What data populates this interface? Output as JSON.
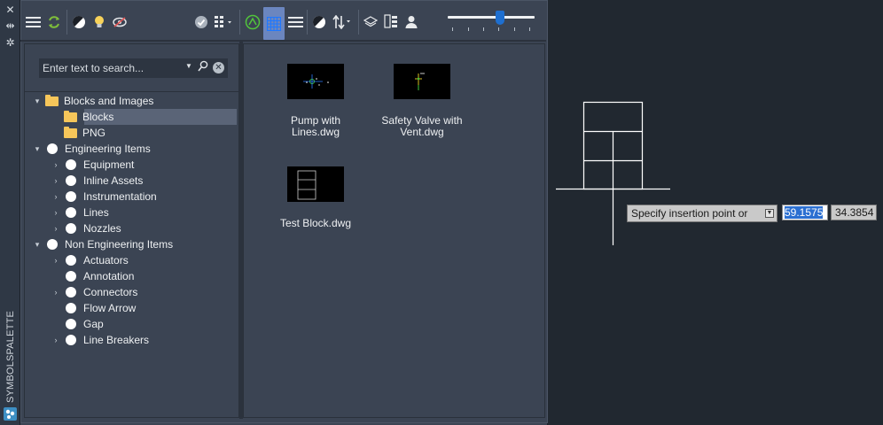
{
  "window": {
    "vertical_title": "SYMBOLSPALETTE"
  },
  "search": {
    "placeholder": "Enter text to search..."
  },
  "tree": [
    {
      "label": "Blocks and Images",
      "level": 0,
      "expander": "expanded",
      "icon": "folder-icon"
    },
    {
      "label": "Blocks",
      "level": 1,
      "expander": "none",
      "icon": "folder-icon",
      "selected": true
    },
    {
      "label": "PNG",
      "level": 1,
      "expander": "none",
      "icon": "folder-icon"
    },
    {
      "label": "Engineering Items",
      "level": 0,
      "expander": "expanded",
      "icon": "circle-icon"
    },
    {
      "label": "Equipment",
      "level": 1,
      "expander": "collapsed",
      "icon": "circle-icon"
    },
    {
      "label": "Inline Assets",
      "level": 1,
      "expander": "collapsed",
      "icon": "circle-icon"
    },
    {
      "label": "Instrumentation",
      "level": 1,
      "expander": "collapsed",
      "icon": "circle-icon"
    },
    {
      "label": "Lines",
      "level": 1,
      "expander": "collapsed",
      "icon": "circle-icon"
    },
    {
      "label": "Nozzles",
      "level": 1,
      "expander": "collapsed",
      "icon": "circle-icon"
    },
    {
      "label": "Non Engineering Items",
      "level": 0,
      "expander": "expanded",
      "icon": "circle-icon"
    },
    {
      "label": "Actuators",
      "level": 1,
      "expander": "collapsed",
      "icon": "circle-icon"
    },
    {
      "label": "Annotation",
      "level": 1,
      "expander": "none",
      "icon": "circle-icon"
    },
    {
      "label": "Connectors",
      "level": 1,
      "expander": "collapsed",
      "icon": "circle-icon"
    },
    {
      "label": "Flow Arrow",
      "level": 1,
      "expander": "none",
      "icon": "circle-icon"
    },
    {
      "label": "Gap",
      "level": 1,
      "expander": "none",
      "icon": "circle-icon"
    },
    {
      "label": "Line Breakers",
      "level": 1,
      "expander": "collapsed",
      "icon": "circle-icon"
    }
  ],
  "thumbnails": [
    {
      "name": "Pump with Lines.dwg"
    },
    {
      "name": "Safety Valve with Vent.dwg"
    },
    {
      "name": "Test Block.dwg"
    }
  ],
  "toolbar": {
    "zoom_slider_fraction": 0.6
  },
  "command": {
    "prompt": "Specify insertion point or",
    "x_value": "59.1575",
    "y_value": "34.3854"
  },
  "colors": {
    "panel": "#3b4453",
    "background": "#212830",
    "selection": "#5a6477",
    "accent": "#6b86bf",
    "folder": "#f6c65a"
  }
}
